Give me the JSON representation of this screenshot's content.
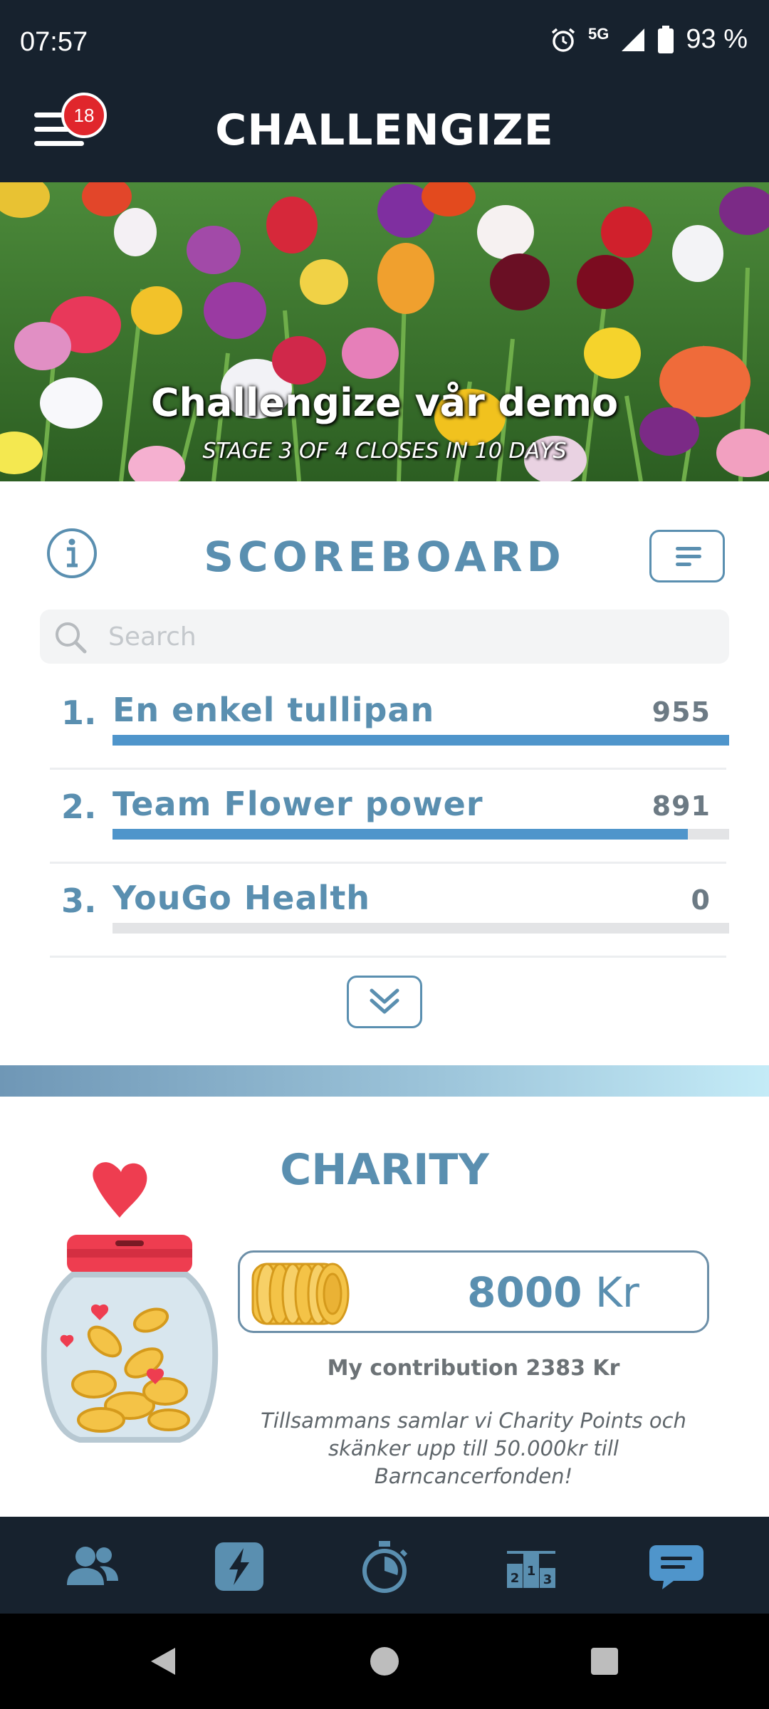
{
  "status_bar": {
    "time": "07:57",
    "network": "5G",
    "battery": "93 %",
    "icons": [
      "alarm-icon",
      "signal-icon",
      "battery-icon"
    ]
  },
  "header": {
    "title": "CHALLENGIZE",
    "notification_count": "18"
  },
  "banner": {
    "title": "Challengize vår demo",
    "subtitle": "STAGE 3 OF 4 CLOSES IN 10 DAYS"
  },
  "scoreboard": {
    "title": "SCOREBOARD",
    "search_placeholder": "Search",
    "rows": [
      {
        "rank": "1.",
        "name": "En enkel tullipan",
        "score": "955",
        "progress": 1.0
      },
      {
        "rank": "2.",
        "name": "Team Flower power",
        "score": "891",
        "progress": 0.933
      },
      {
        "rank": "3.",
        "name": "YouGo Health",
        "score": "0",
        "progress": 0.0
      }
    ]
  },
  "charity": {
    "title": "CHARITY",
    "amount": "8000",
    "currency": "Kr",
    "my_contribution": "My contribution 2383 Kr",
    "description": "Tillsammans samlar vi Charity Points och skänker upp till 50.000kr till Barncancerfonden!"
  },
  "bottom_nav": {
    "items": [
      "team-icon",
      "challenge-bolt-icon",
      "stopwatch-icon",
      "podium-icon",
      "chat-icon"
    ],
    "active_index": 1
  },
  "colors": {
    "dark": "#17222e",
    "accent": "#5a8fb0",
    "bar": "#4f95cb",
    "badge": "#e0262c"
  }
}
